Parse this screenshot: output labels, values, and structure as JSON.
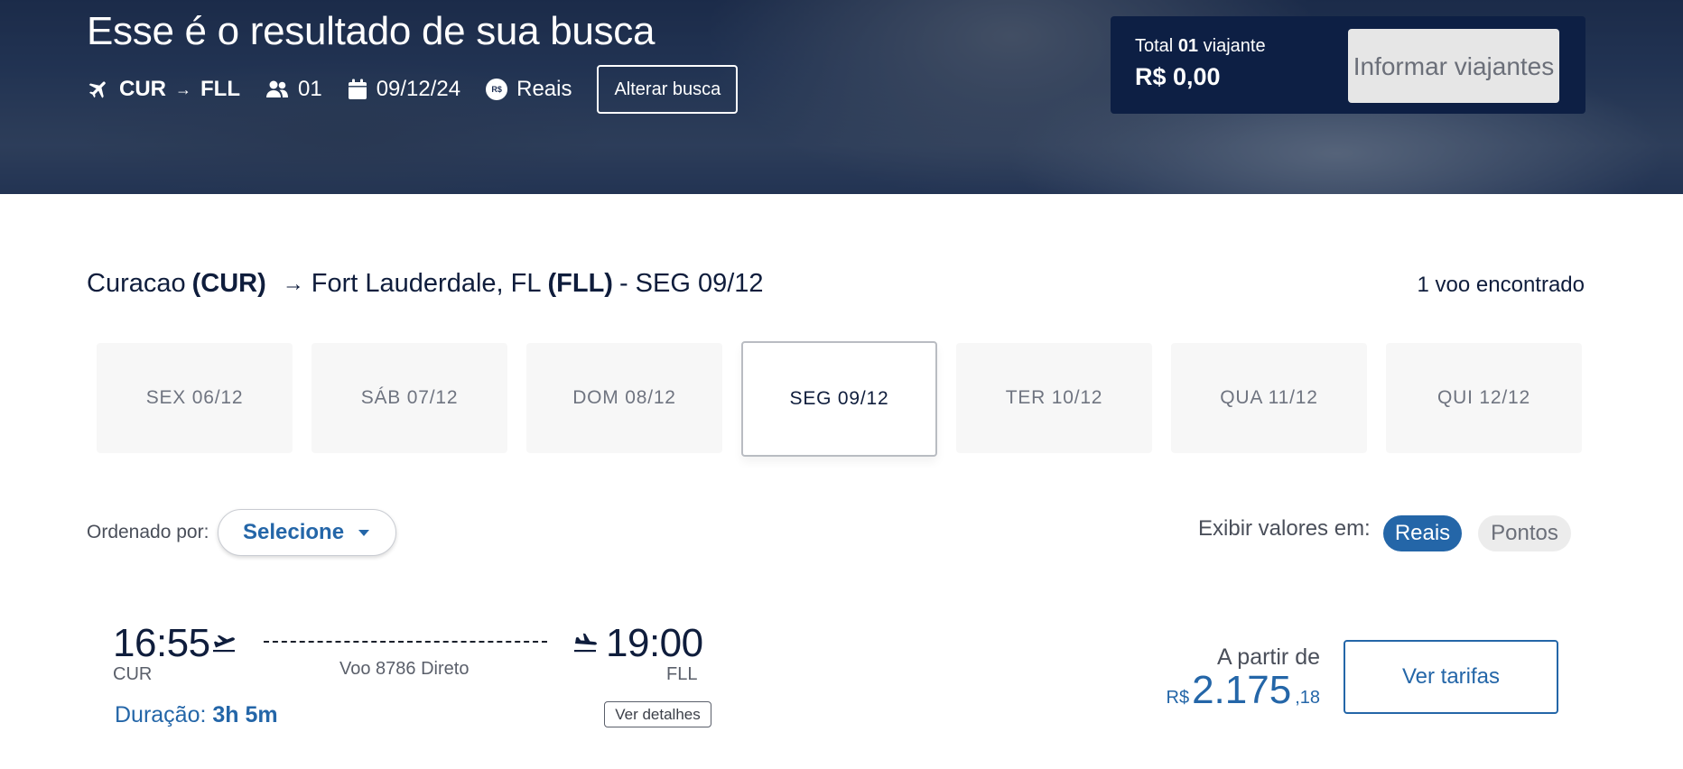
{
  "hero": {
    "title": "Esse é o resultado de sua busca",
    "origin": "CUR",
    "destination": "FLL",
    "passengers": "01",
    "date": "09/12/24",
    "currency": "Reais",
    "alter_button": "Alterar busca"
  },
  "total": {
    "label_prefix": "Total",
    "count": "01",
    "label_suffix": "viajante",
    "value": "R$ 0,00",
    "inform_button": "Informar viajantes"
  },
  "route": {
    "origin_city": "Curacao",
    "origin_code": "(CUR)",
    "destination_city": "Fort Lauderdale, FL",
    "destination_code": "(FLL)",
    "date_suffix": "- SEG 09/12",
    "found": "1 voo encontrado"
  },
  "days": [
    {
      "label": "SEX 06/12"
    },
    {
      "label": "SÁB 07/12"
    },
    {
      "label": "DOM 08/12"
    },
    {
      "label": "SEG 09/12",
      "active": true
    },
    {
      "label": "TER 10/12"
    },
    {
      "label": "QUA 11/12"
    },
    {
      "label": "QUI 12/12"
    }
  ],
  "sort": {
    "label": "Ordenado por:",
    "value": "Selecione"
  },
  "display": {
    "label": "Exibir valores em:",
    "options": [
      "Reais",
      "Pontos"
    ],
    "selected": "Reais"
  },
  "flight": {
    "departure_time": "16:55",
    "departure_code": "CUR",
    "arrival_time": "19:00",
    "arrival_code": "FLL",
    "info": "Voo 8786 Direto",
    "duration_label": "Duração:",
    "duration_value": "3h 5m",
    "details_button": "Ver detalhes",
    "price_from": "A partir de",
    "price_currency": "R$",
    "price_integer": "2.175",
    "price_cents": ",18",
    "fares_button": "Ver tarifas"
  },
  "colors": {
    "navy": "#0d1f44",
    "accent_blue": "#2466a8",
    "text_dark": "#0f1d3c"
  }
}
